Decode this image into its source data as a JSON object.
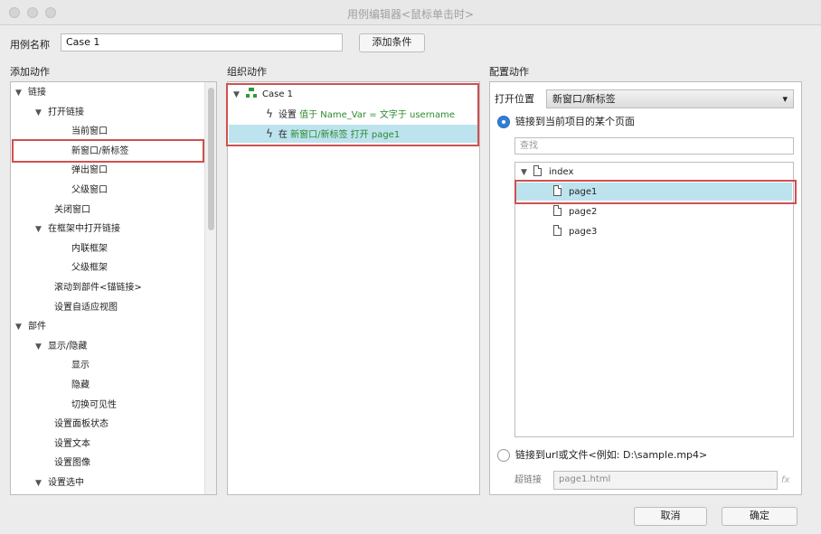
{
  "window": {
    "title": "用例编辑器<鼠标单击时>"
  },
  "case_name": {
    "label": "用例名称",
    "value": "Case 1",
    "add_condition": "添加条件"
  },
  "add_actions": {
    "header": "添加动作",
    "items": [
      {
        "label": "链接",
        "arrow": "▼"
      },
      {
        "label": "打开链接",
        "arrow": "▼"
      },
      {
        "label": "当前窗口"
      },
      {
        "label": "新窗口/新标签"
      },
      {
        "label": "弹出窗口"
      },
      {
        "label": "父级窗口"
      },
      {
        "label": "关闭窗口"
      },
      {
        "label": "在框架中打开链接",
        "arrow": "▼"
      },
      {
        "label": "内联框架"
      },
      {
        "label": "父级框架"
      },
      {
        "label": "滚动到部件<锚链接>"
      },
      {
        "label": "设置自适应视图"
      },
      {
        "label": "部件",
        "arrow": "▼"
      },
      {
        "label": "显示/隐藏",
        "arrow": "▼"
      },
      {
        "label": "显示"
      },
      {
        "label": "隐藏"
      },
      {
        "label": "切换可见性"
      },
      {
        "label": "设置面板状态"
      },
      {
        "label": "设置文本"
      },
      {
        "label": "设置图像"
      },
      {
        "label": "设置选中",
        "arrow": "▼"
      }
    ]
  },
  "organize_actions": {
    "header": "组织动作",
    "case_label": "Case 1",
    "case_arrow": "▼",
    "action1": {
      "prefix": "设置",
      "detail": "值于 Name_Var = 文字于 username"
    },
    "action2": {
      "prefix": "在",
      "detail": "新窗口/新标签",
      "suffix": "打开 page1"
    }
  },
  "configure_actions": {
    "header": "配置动作",
    "open_in_label": "打开位置",
    "open_in_value": "新窗口/新标签",
    "dropdown_arrow": "▾",
    "radio_page_label": "链接到当前项目的某个页面",
    "search_placeholder": "查找",
    "pages": {
      "root": "index",
      "root_arrow": "▼",
      "children": [
        "page1",
        "page2",
        "page3"
      ]
    },
    "radio_url_label": "链接到url或文件<例如: D:\\sample.mp4>",
    "hyperlink_label": "超链接",
    "hyperlink_value": "page1.html",
    "fx": "fx"
  },
  "footer": {
    "cancel": "取消",
    "ok": "确定"
  }
}
